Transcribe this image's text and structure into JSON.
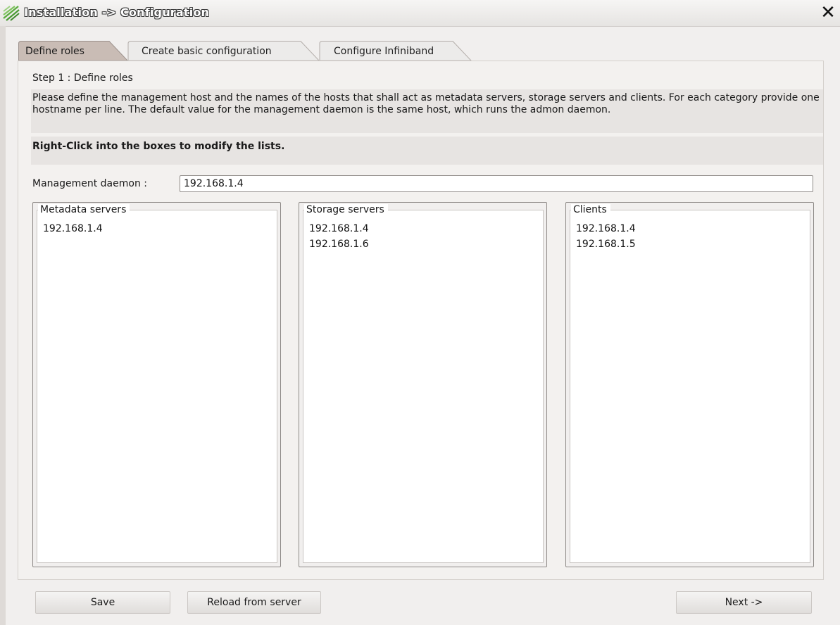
{
  "window": {
    "title": "Installation -> Configuration",
    "close_label": "✕"
  },
  "tabs": [
    {
      "label": "Define roles",
      "active": true
    },
    {
      "label": "Create basic configuration",
      "active": false
    },
    {
      "label": "Configure Infiniband",
      "active": false
    }
  ],
  "step": {
    "label": "Step 1 : Define roles",
    "description": "Please define the management host and the names of the hosts that shall act as metadata servers, storage servers and clients. For each category provide one hostname per line. The default value for the management daemon is the same host, which runs the admon daemon.",
    "hint": "Right-Click into the boxes to modify the lists."
  },
  "management": {
    "label": "Management daemon :",
    "value": "192.168.1.4"
  },
  "groups": {
    "metadata": {
      "title": "Metadata servers",
      "hosts": [
        "192.168.1.4"
      ]
    },
    "storage": {
      "title": "Storage servers",
      "hosts": [
        "192.168.1.4",
        "192.168.1.6"
      ]
    },
    "clients": {
      "title": "Clients",
      "hosts": [
        "192.168.1.4",
        "192.168.1.5"
      ]
    }
  },
  "buttons": {
    "save": "Save",
    "reload": "Reload from server",
    "next": "Next ->"
  },
  "colors": {
    "active_tab": "#c9bcb5",
    "inactive_tab": "#ecebea",
    "logo_green": "#5cae3f"
  }
}
